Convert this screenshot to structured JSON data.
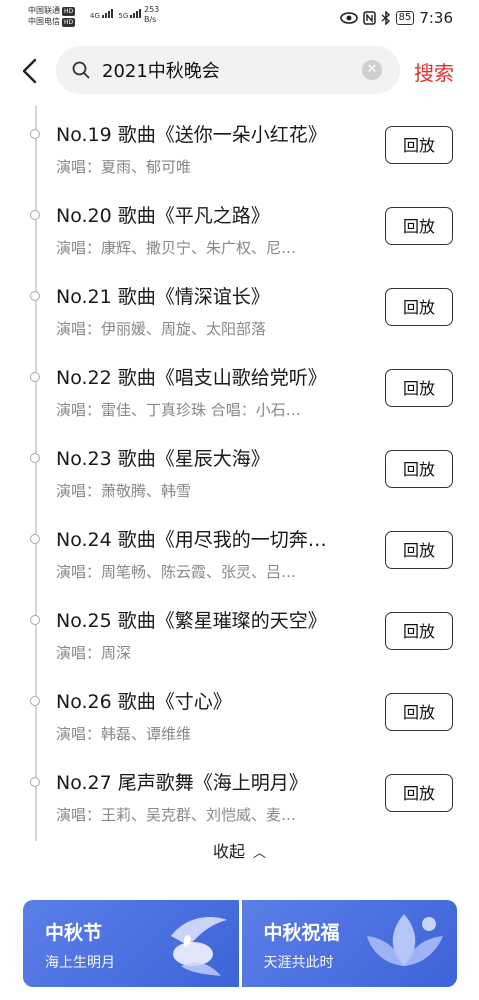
{
  "status_bar": {
    "carrier1": "中国联通",
    "carrier2": "中国电信",
    "hd": "HD",
    "net1": "4G",
    "net2": "5G",
    "speed_value": "253",
    "speed_unit": "B/s",
    "battery": "85",
    "time": "7:36"
  },
  "search": {
    "query": "2021中秋晚会",
    "submit_label": "搜索"
  },
  "programs": [
    {
      "title": "No.19 歌曲《送你一朵小红花》",
      "performers": "演唱：夏雨、郁可唯",
      "action": "回放"
    },
    {
      "title": "No.20 歌曲《平凡之路》",
      "performers": "演唱：康辉、撒贝宁、朱广权、尼…",
      "action": "回放"
    },
    {
      "title": "No.21 歌曲《情深谊长》",
      "performers": "演唱：伊丽媛、周旋、太阳部落",
      "action": "回放"
    },
    {
      "title": "No.22 歌曲《唱支山歌给党听》",
      "performers": "演唱：雷佳、丁真珍珠 合唱：小石…",
      "action": "回放"
    },
    {
      "title": "No.23 歌曲《星辰大海》",
      "performers": "演唱：萧敬腾、韩雪",
      "action": "回放"
    },
    {
      "title": "No.24 歌曲《用尽我的一切奔…",
      "performers": "演唱：周笔畅、陈云霞、张灵、吕…",
      "action": "回放"
    },
    {
      "title": "No.25 歌曲《繁星璀璨的天空》",
      "performers": "演唱：周深",
      "action": "回放"
    },
    {
      "title": "No.26 歌曲《寸心》",
      "performers": "演唱：韩磊、谭维维",
      "action": "回放"
    },
    {
      "title": "No.27 尾声歌舞《海上明月》",
      "performers": "演唱：王莉、吴克群、刘恺威、麦…",
      "action": "回放"
    }
  ],
  "collapse_label": "收起",
  "cards": [
    {
      "title": "中秋节",
      "subtitle": "海上生明月"
    },
    {
      "title": "中秋祝福",
      "subtitle": "天涯共此时"
    }
  ]
}
